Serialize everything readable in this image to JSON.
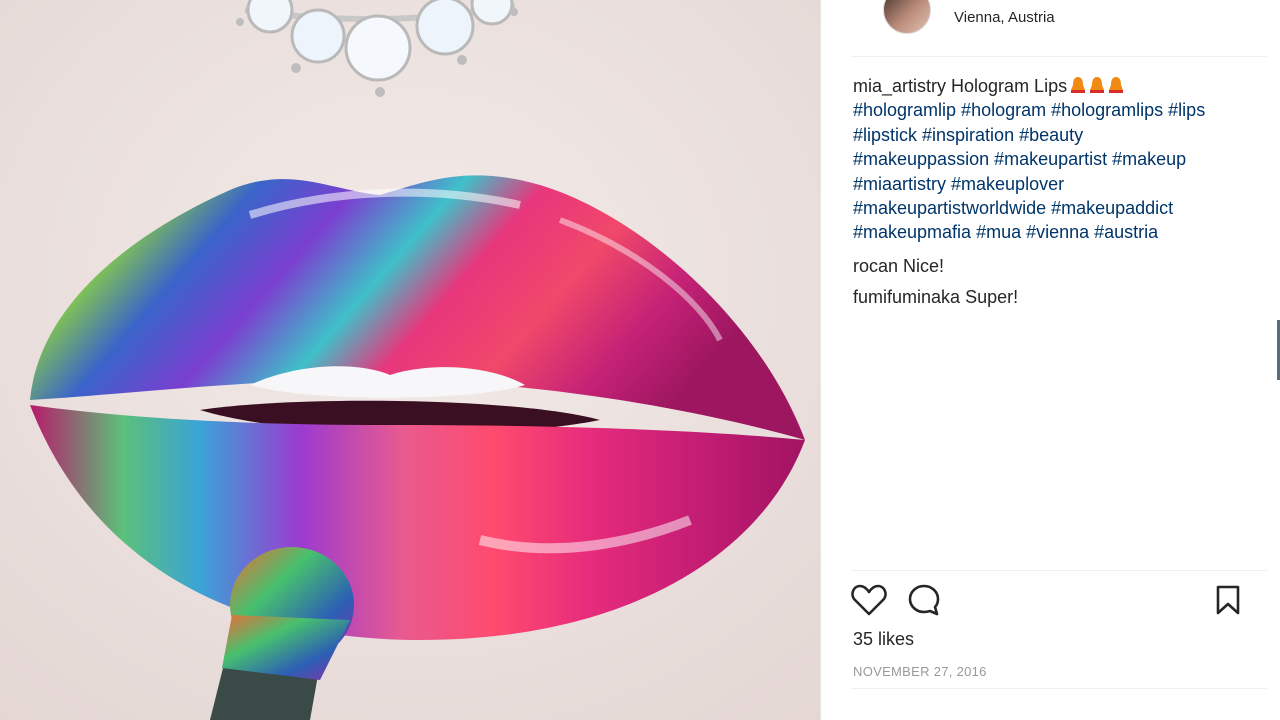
{
  "post": {
    "location": "Vienna, Austria",
    "caption_user": "mia_artistry",
    "caption_title": "Hologram Lips",
    "hashtags_lines": [
      "#hologramlip #hologram #hologramlips #lips",
      "#lipstick #inspiration #beauty",
      "#makeuppassion #makeupartist #makeup",
      "#miaartistry #makeuplover",
      "#makeupartistworldwide #makeupaddict",
      "#makeupmafia #mua #vienna #austria"
    ],
    "comments": [
      {
        "user": "rocan",
        "text": "Nice!"
      },
      {
        "user": "fumifuminaka",
        "text": "Super!"
      }
    ],
    "likes": "35 likes",
    "date": "NOVEMBER 27, 2016"
  },
  "icons": {
    "like": "heart-icon",
    "comment": "comment-icon",
    "save": "bookmark-icon",
    "caption_emoji": "bell-icon"
  },
  "colors": {
    "hashtag": "#003569",
    "text": "#262626",
    "muted": "#999999"
  }
}
